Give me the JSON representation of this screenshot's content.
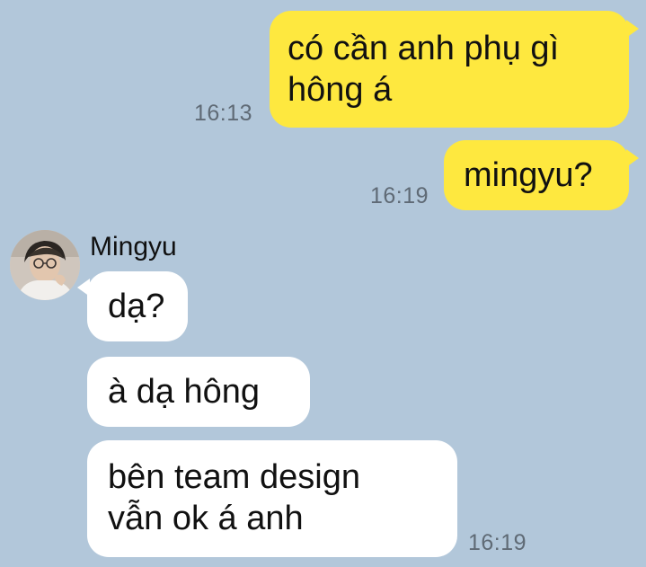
{
  "chat": {
    "messages": [
      {
        "direction": "out",
        "text": "có cần anh phụ gì\nhông á",
        "time": "16:13"
      },
      {
        "direction": "out",
        "text": "mingyu?",
        "time": "16:19"
      },
      {
        "direction": "in",
        "text": "dạ?"
      },
      {
        "direction": "in",
        "text": "à dạ hông"
      },
      {
        "direction": "in",
        "text": "bên team design\nvẫn ok á anh",
        "time": "16:19"
      }
    ],
    "contact": {
      "name": "Mingyu",
      "avatar_icon": "user-avatar-photo"
    }
  },
  "colors": {
    "background": "#b2c7da",
    "outgoing_bubble": "#fee83f",
    "incoming_bubble": "#ffffff",
    "timestamp": "#5f6a75"
  }
}
